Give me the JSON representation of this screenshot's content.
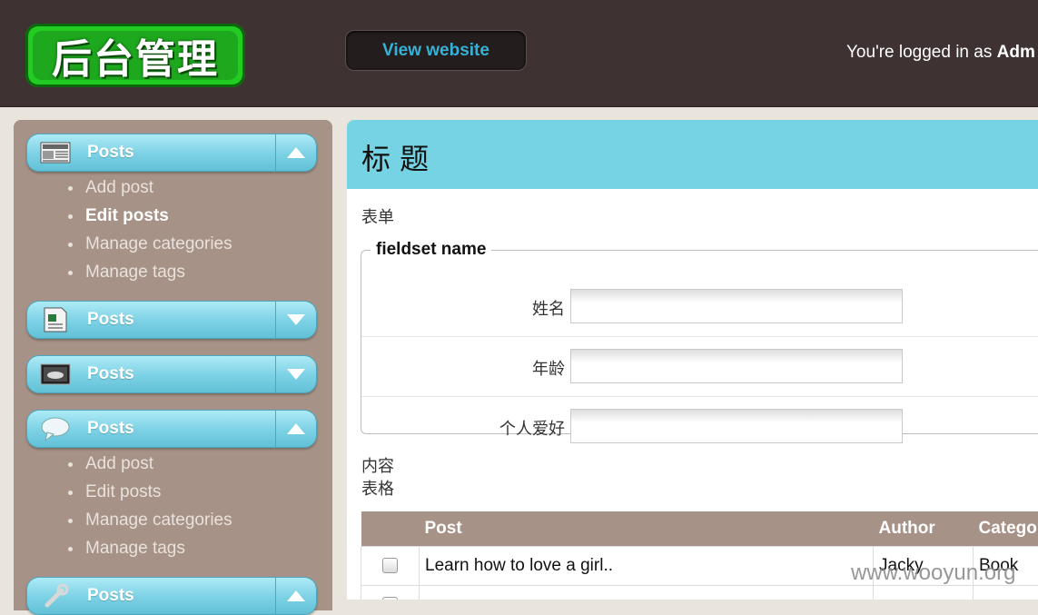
{
  "header": {
    "logo_text": "后台管理",
    "view_website": "View website",
    "logged_in_prefix": "You're logged in as ",
    "logged_in_user": "Adm"
  },
  "sidebar": {
    "sections": [
      {
        "label": "Posts",
        "icon": "newspaper-icon",
        "expanded": true,
        "items": [
          "Add post",
          "Edit posts",
          "Manage categories",
          "Manage tags"
        ],
        "active_item": "Edit posts"
      },
      {
        "label": "Posts",
        "icon": "document-icon",
        "expanded": false
      },
      {
        "label": "Posts",
        "icon": "image-icon",
        "expanded": false
      },
      {
        "label": "Posts",
        "icon": "speech-bubble-icon",
        "expanded": true,
        "items": [
          "Add post",
          "Edit posts",
          "Manage categories",
          "Manage tags"
        ]
      },
      {
        "label": "Posts",
        "icon": "wrench-icon",
        "expanded": true
      }
    ]
  },
  "main": {
    "title": "标 题",
    "form_label": "表单",
    "fieldset": {
      "legend": "fieldset name",
      "fields": [
        {
          "label": "姓名",
          "value": ""
        },
        {
          "label": "年龄",
          "value": ""
        },
        {
          "label": "个人爱好",
          "value": ""
        }
      ]
    },
    "content_label": "内容",
    "table_label": "表格",
    "table": {
      "headers": [
        "",
        "Post",
        "Author",
        "Catego"
      ],
      "rows": [
        {
          "post": "Learn how to love a girl..",
          "author": "Jacky",
          "category": "Book"
        }
      ]
    }
  },
  "watermark": "www.wooyun.org",
  "colors": {
    "header_bg": "#3e3232",
    "accent": "#75d3e3",
    "sidebar_bg": "#a69286",
    "link": "#35b2d8"
  }
}
